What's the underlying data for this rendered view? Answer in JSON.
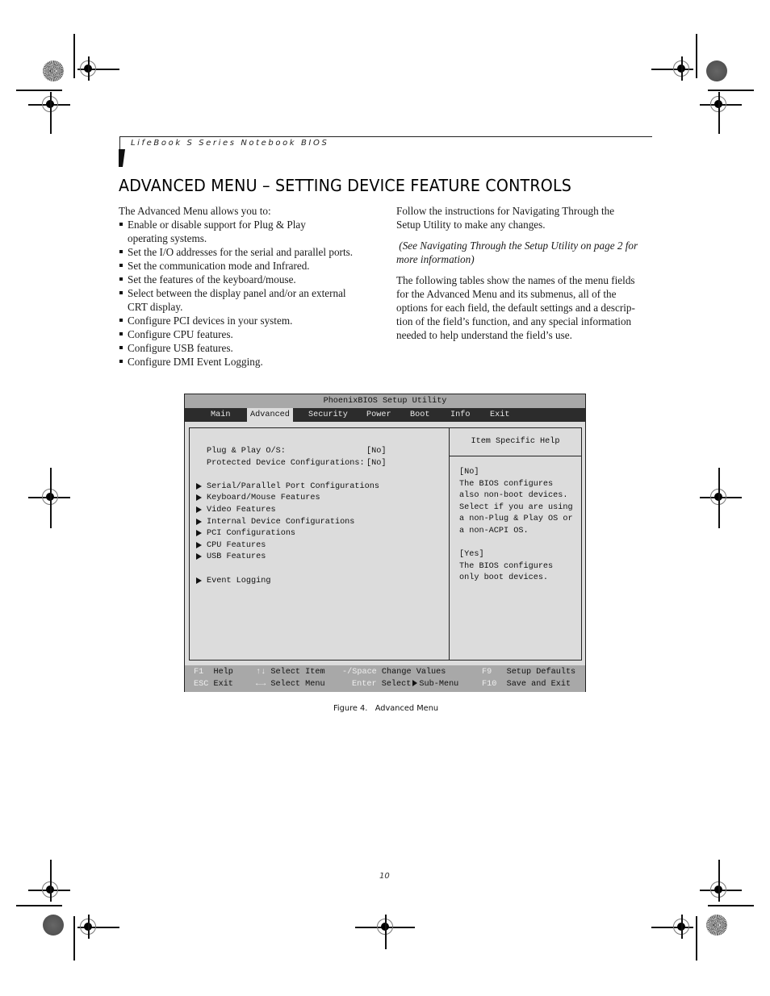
{
  "running_head": "LifeBook S Series Notebook BIOS",
  "page_title": "ADVANCED MENU – SETTING DEVICE FEATURE CONTROLS",
  "left_column": {
    "intro": "The Advanced Menu allows you to:",
    "bullets": [
      [
        "Enable or disable support for Plug & Play",
        "operating systems."
      ],
      [
        "Set the I/O addresses for the serial and parallel ports."
      ],
      [
        "Set the communication mode and Infrared."
      ],
      [
        "Set the features of the keyboard/mouse."
      ],
      [
        "Select between the display panel and/or an external",
        "CRT display."
      ],
      [
        "Configure PCI devices in your system."
      ],
      [
        "Configure CPU features."
      ],
      [
        "Configure USB features."
      ],
      [
        "Configure DMI Event Logging."
      ]
    ]
  },
  "right_column": {
    "paragraphs": [
      {
        "lines": [
          "Follow the instructions for Navigating Through the",
          "Setup Utility to make any changes."
        ],
        "italic": false
      },
      {
        "lines": [
          " (See Navigating Through the Setup Utility on page 2 for",
          "more information)"
        ],
        "italic": true
      },
      {
        "lines": [
          "The following tables show the names of the menu fields",
          "for the Advanced Menu and its submenus, all of the",
          "options for each field, the default settings and a descrip-",
          "tion of the field’s function, and any special information",
          "needed to help understand the field’s use."
        ],
        "italic": false
      }
    ]
  },
  "bios": {
    "title": "PhoenixBIOS Setup Utility",
    "tabs": [
      "Main",
      "Advanced",
      "Security",
      "Power",
      "Boot",
      "Info",
      "Exit"
    ],
    "active_tab": "Advanced",
    "settings": [
      {
        "label": "Plug & Play O/S:",
        "value": "[No]"
      },
      {
        "label": "Protected Device Configurations:",
        "value": "[No]"
      }
    ],
    "submenus": [
      "Serial/Parallel Port Configurations",
      "Keyboard/Mouse Features",
      "Video Features",
      "Internal Device Configurations",
      "PCI Configurations",
      "CPU Features",
      "USB Features",
      "Event Logging"
    ],
    "help": {
      "heading": "Item Specific Help",
      "text": "[No]\nThe BIOS configures\nalso non-boot devices.\nSelect if you are using\na non-Plug & Play OS or\na non-ACPI OS.\n\n[Yes]\nThe BIOS configures\nonly boot devices."
    },
    "footer": {
      "row1": [
        {
          "key": "F1",
          "action": "Help"
        },
        {
          "key": "↑↓",
          "action": "Select Item"
        },
        {
          "key": "-/Space",
          "action": "Change Values"
        },
        {
          "key": "F9",
          "action": "Setup Defaults"
        }
      ],
      "row2": [
        {
          "key": "ESC",
          "action": "Exit"
        },
        {
          "key": "←→",
          "action": "Select Menu"
        },
        {
          "key": "Enter",
          "action_pre": "Select",
          "action_post": "Sub-Menu"
        },
        {
          "key": "F10",
          "action": "Save and Exit"
        }
      ]
    }
  },
  "caption": "Figure 4.   Advanced Menu",
  "page_number": "10"
}
